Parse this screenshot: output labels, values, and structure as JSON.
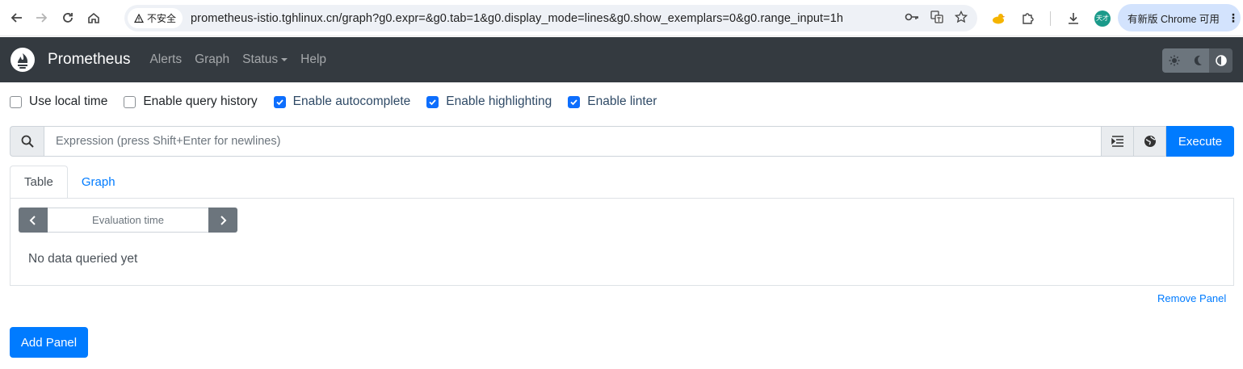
{
  "browser": {
    "security_label": "不安全",
    "url": "prometheus-istio.tghlinux.cn/graph?g0.expr=&g0.tab=1&g0.display_mode=lines&g0.show_exemplars=0&g0.range_input=1h",
    "profile_initials": "天才",
    "update_label": "有新版 Chrome 可用"
  },
  "navbar": {
    "brand": "Prometheus",
    "links": [
      "Alerts",
      "Graph",
      "Status",
      "Help"
    ]
  },
  "settings": {
    "items": [
      {
        "label": "Use local time",
        "checked": false
      },
      {
        "label": "Enable query history",
        "checked": false
      },
      {
        "label": "Enable autocomplete",
        "checked": true
      },
      {
        "label": "Enable highlighting",
        "checked": true
      },
      {
        "label": "Enable linter",
        "checked": true
      }
    ]
  },
  "expression": {
    "placeholder": "Expression (press Shift+Enter for newlines)",
    "execute_label": "Execute"
  },
  "panel": {
    "tabs": [
      {
        "label": "Table",
        "active": true
      },
      {
        "label": "Graph",
        "active": false
      }
    ],
    "eval_time_placeholder": "Evaluation time",
    "empty_message": "No data queried yet",
    "remove_label": "Remove Panel"
  },
  "add_panel_label": "Add Panel",
  "colors": {
    "navbar_bg": "#343a40",
    "primary": "#007bff",
    "secondary": "#6c757d"
  }
}
